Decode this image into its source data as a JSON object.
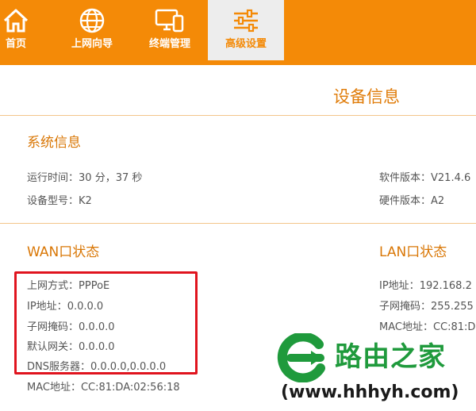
{
  "nav": {
    "items": [
      {
        "label": "首页",
        "icon": "home-icon"
      },
      {
        "label": "上网向导",
        "icon": "globe-icon"
      },
      {
        "label": "终端管理",
        "icon": "devices-icon"
      },
      {
        "label": "高级设置",
        "icon": "sliders-icon",
        "active": true
      }
    ]
  },
  "page": {
    "title": "设备信息"
  },
  "system": {
    "title": "系统信息",
    "uptime_label": "运行时间：",
    "uptime_value": "30 分，37 秒",
    "model_label": "设备型号：",
    "model_value": "K2",
    "software_label": "软件版本：",
    "software_value": "V21.4.6",
    "hardware_label": "硬件版本：",
    "hardware_value": "A2"
  },
  "wan": {
    "title": "WAN口状态",
    "rows": [
      {
        "label": "上网方式：",
        "value": "PPPoE"
      },
      {
        "label": "IP地址：",
        "value": "0.0.0.0"
      },
      {
        "label": "子网掩码：",
        "value": "0.0.0.0"
      },
      {
        "label": "默认网关：",
        "value": "0.0.0.0"
      },
      {
        "label": "DNS服务器：",
        "value": "0.0.0.0,0.0.0.0"
      },
      {
        "label": "MAC地址：",
        "value": "CC:81:DA:02:56:18"
      }
    ]
  },
  "lan": {
    "title": "LAN口状态",
    "rows": [
      {
        "label": "IP地址：",
        "value": "192.168.2"
      },
      {
        "label": "子网掩码：",
        "value": "255.255"
      },
      {
        "label": "MAC地址：",
        "value": "CC:81:D"
      }
    ]
  },
  "watermark": {
    "name": "路由之家",
    "url": "(www.hhhyh.com)"
  },
  "colors": {
    "accent": "#f48a07",
    "section_title": "#d97706",
    "highlight_box": "#e0141e",
    "watermark_green": "#1f9a3c"
  }
}
